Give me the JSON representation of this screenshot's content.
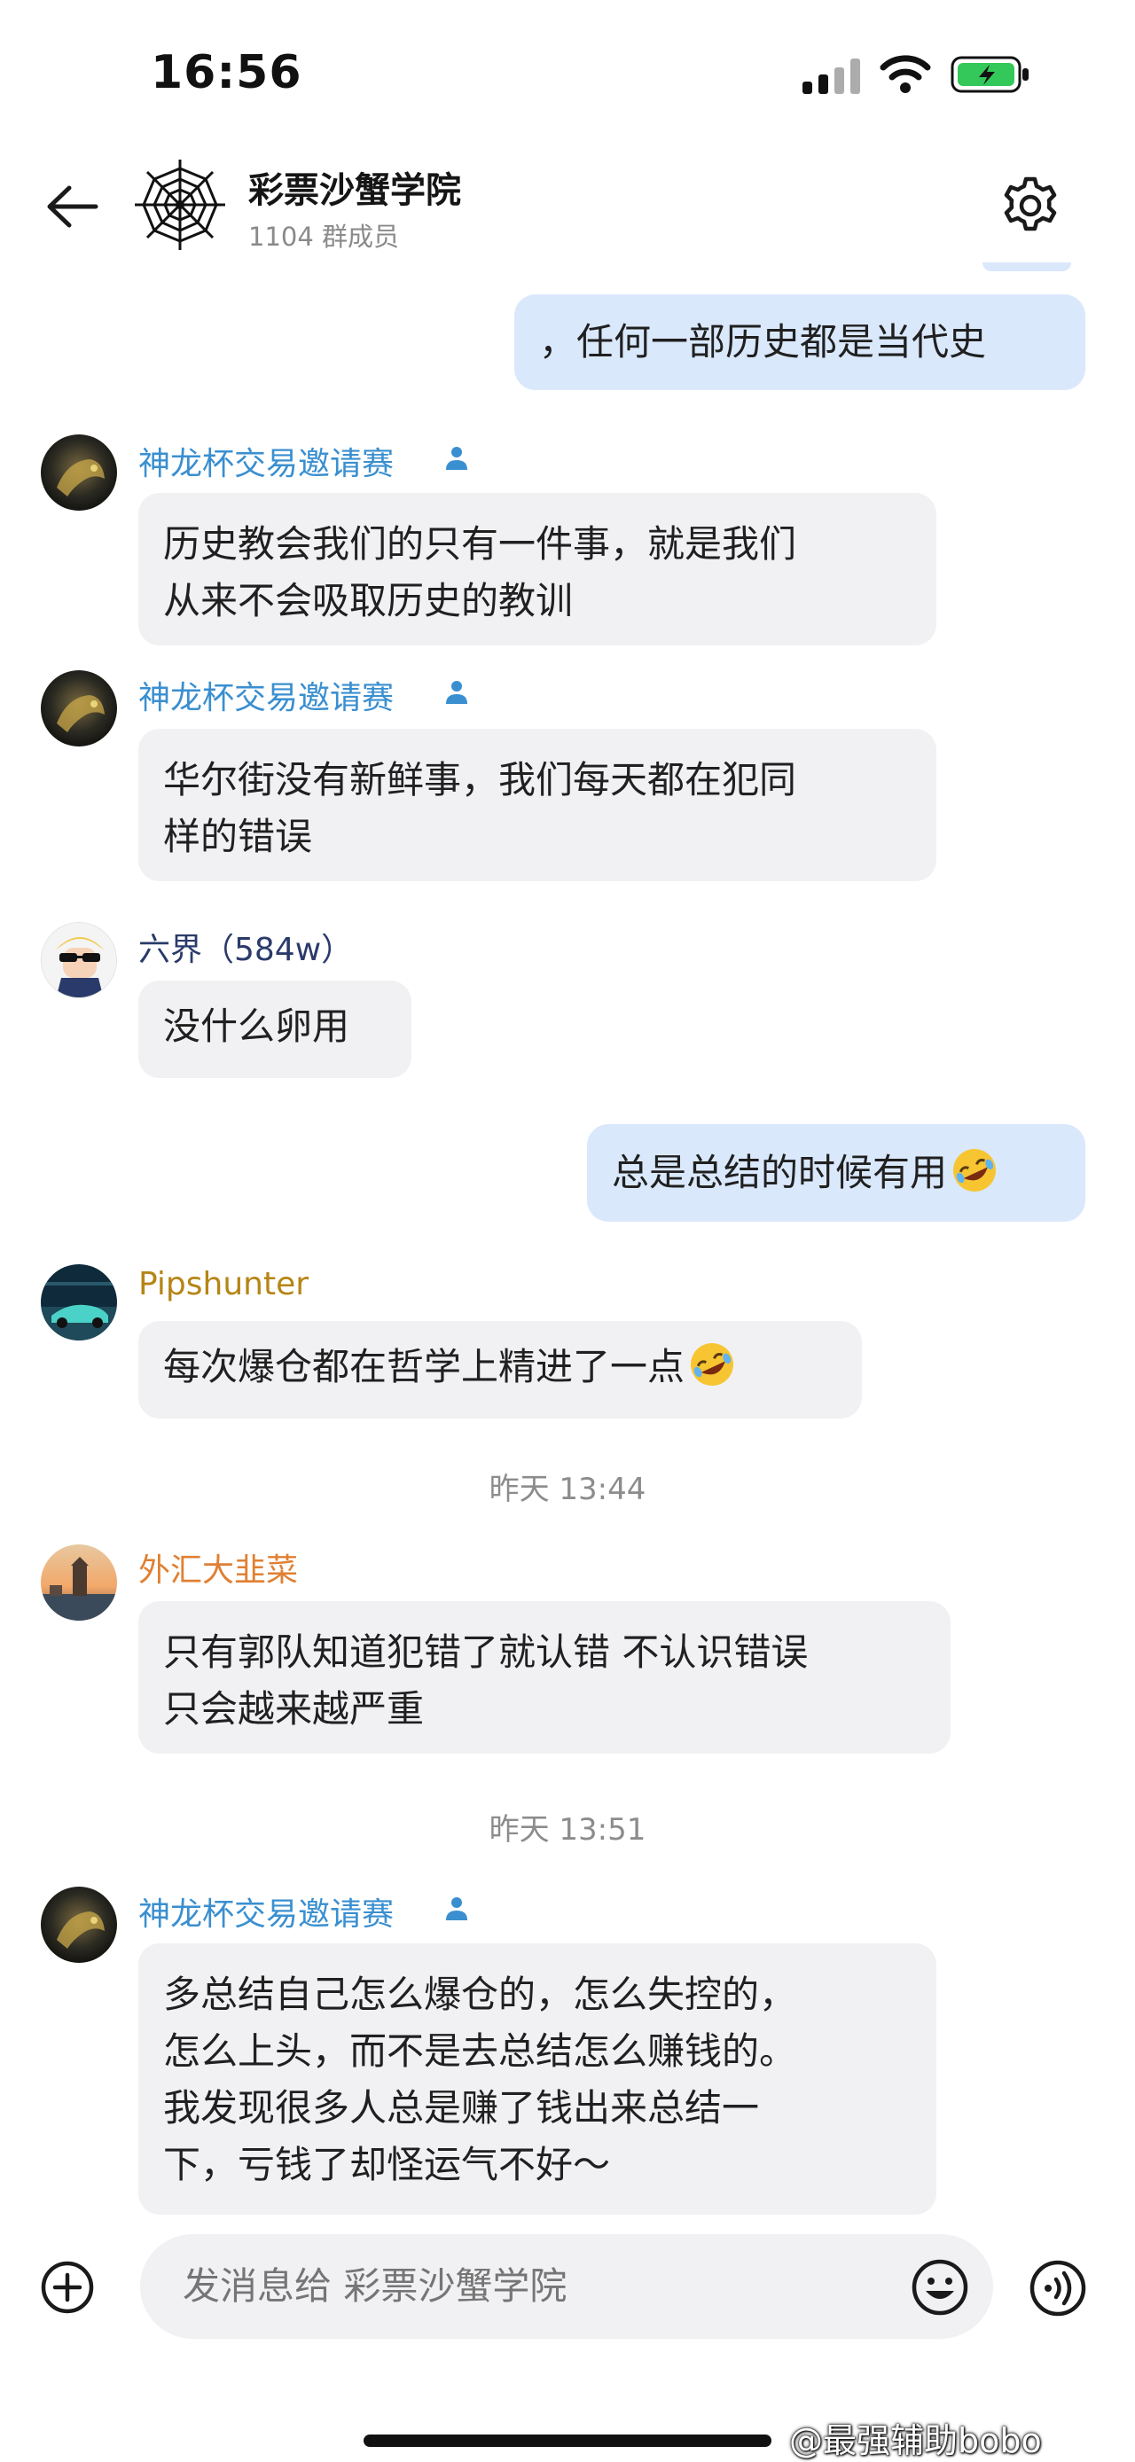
{
  "status_bar": {
    "time": "16:56"
  },
  "header": {
    "title": "彩票沙蟹学院",
    "subtitle": "1104 群成员"
  },
  "messages": [
    {
      "type": "out",
      "text": "，任何一部历史都是当代史"
    },
    {
      "type": "in",
      "sender": "神龙杯交易邀请赛",
      "admin": true,
      "lines": [
        "历史教会我们的只有一件事，就是我们",
        "从来不会吸取历史的教训"
      ]
    },
    {
      "type": "in",
      "sender": "神龙杯交易邀请赛",
      "admin": true,
      "lines": [
        "华尔街没有新鲜事，我们每天都在犯同",
        "样的错误"
      ]
    },
    {
      "type": "in",
      "sender": "六界（584w）",
      "lines": [
        "没什么卵用"
      ]
    },
    {
      "type": "out",
      "text": "总是总结的时候有用",
      "emoji": "rofl-emoji"
    },
    {
      "type": "in",
      "sender": "Pipshunter",
      "lines": [
        "每次爆仓都在哲学上精进了一点"
      ],
      "emoji": "rofl-emoji"
    },
    {
      "type": "timestamp",
      "text": "昨天 13:44"
    },
    {
      "type": "in",
      "sender": "外汇大韭菜",
      "lines": [
        "只有郭队知道犯错了就认错 不认识错误",
        "只会越来越严重"
      ]
    },
    {
      "type": "timestamp",
      "text": "昨天 13:51"
    },
    {
      "type": "in",
      "sender": "神龙杯交易邀请赛",
      "admin": true,
      "lines": [
        "多总结自己怎么爆仓的，怎么失控的，",
        "怎么上头，而不是去总结怎么赚钱的。",
        "我发现很多人总是赚了钱出来总结一",
        "下，亏钱了却怪运气不好～"
      ]
    }
  ],
  "input": {
    "placeholder": "发消息给 彩票沙蟹学院"
  },
  "watermark": "@最强辅助bobo",
  "colors": {
    "out_bubble": "#dae8fc",
    "in_bubble": "#f1f1f4",
    "sender_blue": "#3a8fd0",
    "sender_gold": "#b58515",
    "sender_orange": "#e08033",
    "battery_green": "#34c759"
  },
  "icons": [
    "back-arrow-icon",
    "spider-web-icon",
    "gear-icon",
    "admin-person-icon",
    "plus-icon",
    "smile-icon",
    "voice-icon",
    "rofl-emoji"
  ]
}
